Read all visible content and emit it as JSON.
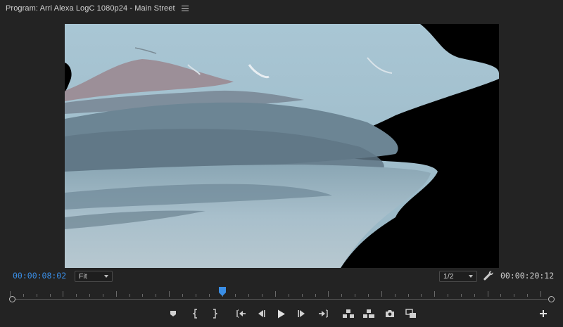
{
  "panel": {
    "title": "Program: Arri Alexa LogC 1080p24 - Main Street",
    "menu_icon": "hamburger-menu-icon"
  },
  "playback": {
    "current_timecode": "00:00:08:02",
    "duration_timecode": "00:00:20:12",
    "zoom_label": "Fit",
    "resolution_label": "1/2",
    "playhead_position_fraction": 0.4
  },
  "colors": {
    "current_timecode": "#3a8ee6",
    "playhead": "#3a8ee6",
    "background": "#232323"
  },
  "transport_controls": [
    {
      "name": "add-marker-icon"
    },
    {
      "name": "mark-in-icon"
    },
    {
      "name": "mark-out-icon"
    },
    {
      "name": "go-to-in-icon"
    },
    {
      "name": "step-back-icon"
    },
    {
      "name": "play-icon"
    },
    {
      "name": "step-forward-icon"
    },
    {
      "name": "go-to-out-icon"
    },
    {
      "name": "lift-icon"
    },
    {
      "name": "extract-icon"
    },
    {
      "name": "export-frame-icon"
    },
    {
      "name": "comparison-view-icon"
    },
    {
      "name": "button-editor-plus-icon"
    }
  ]
}
